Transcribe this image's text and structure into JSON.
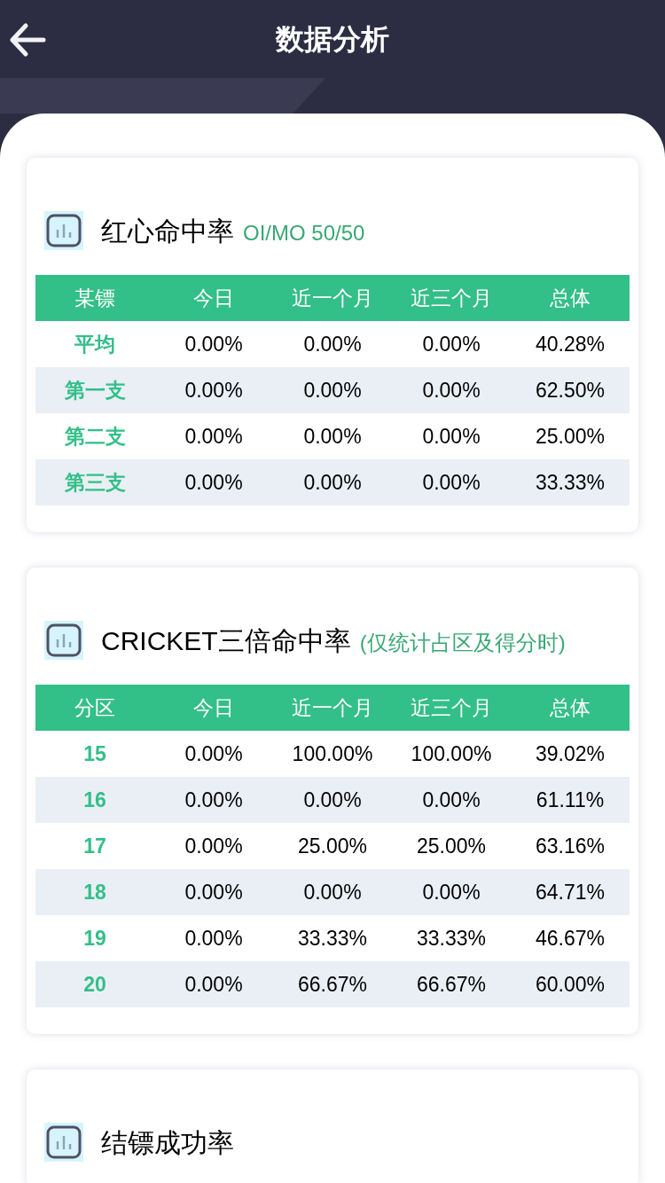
{
  "header": {
    "title": "数据分析"
  },
  "sections": [
    {
      "title": "红心命中率",
      "subtitle": "OI/MO 50/50",
      "columns": [
        "某镖",
        "今日",
        "近一个月",
        "近三个月",
        "总体"
      ],
      "rows": [
        [
          "平均",
          "0.00%",
          "0.00%",
          "0.00%",
          "40.28%"
        ],
        [
          "第一支",
          "0.00%",
          "0.00%",
          "0.00%",
          "62.50%"
        ],
        [
          "第二支",
          "0.00%",
          "0.00%",
          "0.00%",
          "25.00%"
        ],
        [
          "第三支",
          "0.00%",
          "0.00%",
          "0.00%",
          "33.33%"
        ]
      ]
    },
    {
      "title": "CRICKET三倍命中率",
      "subtitle": "(仅统计占区及得分时)",
      "columns": [
        "分区",
        "今日",
        "近一个月",
        "近三个月",
        "总体"
      ],
      "rows": [
        [
          "15",
          "0.00%",
          "100.00%",
          "100.00%",
          "39.02%"
        ],
        [
          "16",
          "0.00%",
          "0.00%",
          "0.00%",
          "61.11%"
        ],
        [
          "17",
          "0.00%",
          "25.00%",
          "25.00%",
          "63.16%"
        ],
        [
          "18",
          "0.00%",
          "0.00%",
          "0.00%",
          "64.71%"
        ],
        [
          "19",
          "0.00%",
          "33.33%",
          "33.33%",
          "46.67%"
        ],
        [
          "20",
          "0.00%",
          "66.67%",
          "66.67%",
          "60.00%"
        ]
      ]
    },
    {
      "title": "结镖成功率"
    }
  ]
}
